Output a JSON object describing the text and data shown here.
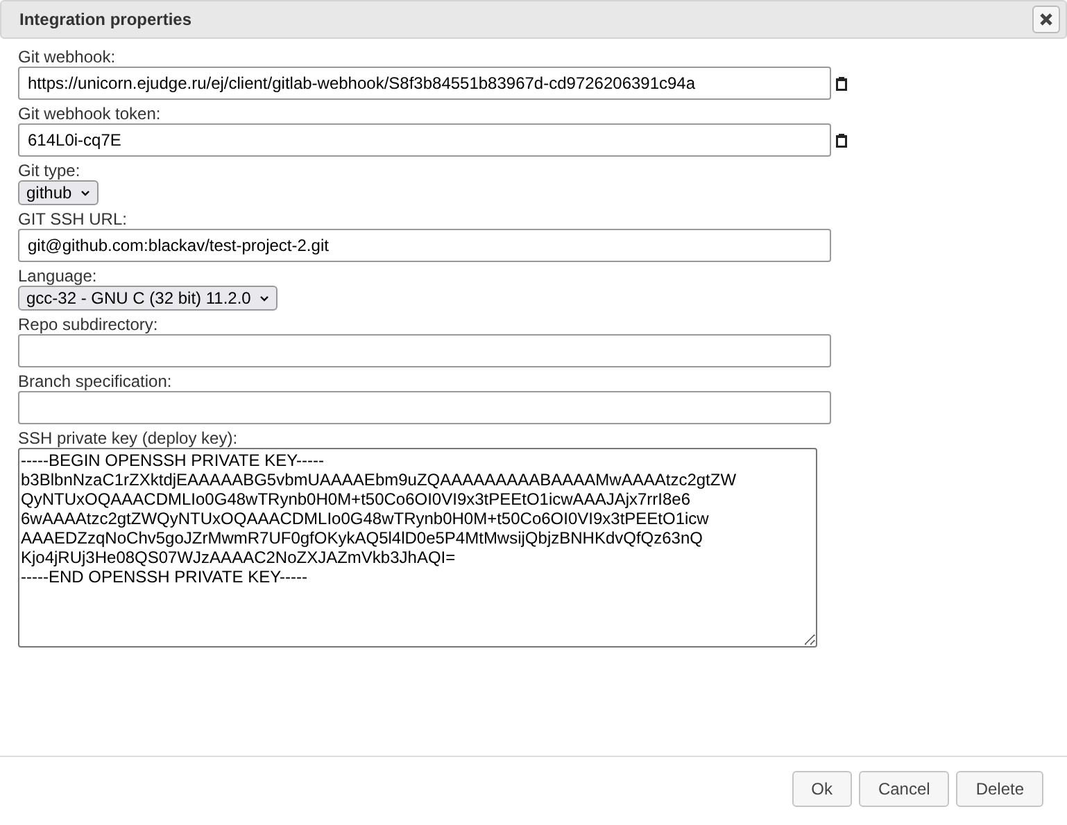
{
  "dialog": {
    "title": "Integration properties"
  },
  "fields": [
    {
      "kind": "text",
      "label": "Git webhook:",
      "value": "https://unicorn.ejudge.ru/ej/client/gitlab-webhook/S8f3b84551b83967d-cd9726206391c94a",
      "copy": true
    },
    {
      "kind": "text",
      "label": "Git webhook token:",
      "value": "614L0i-cq7E",
      "copy": true
    },
    {
      "kind": "select",
      "label": "Git type:",
      "value": "github"
    },
    {
      "kind": "text",
      "label": "GIT SSH URL:",
      "value": "git@github.com:blackav/test-project-2.git",
      "copy": false
    },
    {
      "kind": "select",
      "label": "Language:",
      "value": "gcc-32 - GNU C (32 bit) 11.2.0"
    },
    {
      "kind": "text",
      "label": "Repo subdirectory:",
      "copy": false
    },
    {
      "kind": "text",
      "label": "Branch specification:",
      "copy": false
    },
    {
      "kind": "textarea",
      "label": "SSH private key (deploy key):",
      "value": "-----BEGIN OPENSSH PRIVATE KEY-----\nb3BlbnNzaC1rZXktdjEAAAAABG5vbmUAAAAEbm9uZQAAAAAAAAABAAAAMwAAAAtzc2gtZW\nQyNTUxOQAAACDMLIo0G48wTRynb0H0M+t50Co6OI0VI9x3tPEEtO1icwAAAJAjx7rrI8e6\n6wAAAAtzc2gtZWQyNTUxOQAAACDMLIo0G48wTRynb0H0M+t50Co6OI0VI9x3tPEEtO1icw\nAAAEDZzqNoChv5goJZrMwmR7UF0gfOKykAQ5l4lD0e5P4MtMwsijQbjzBNHKdvQfQz63nQ\nKjo4jRUj3He08QS07WJzAAAAC2NoZXJAZmVkb3JhAQI=\n-----END OPENSSH PRIVATE KEY-----"
    }
  ],
  "buttons": [
    "Ok",
    "Cancel",
    "Delete"
  ]
}
